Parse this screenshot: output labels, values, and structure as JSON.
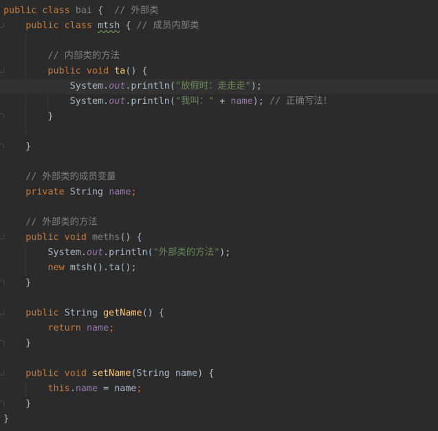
{
  "editor": {
    "lines": [
      [
        {
          "t": "public class ",
          "c": "kw"
        },
        {
          "t": "bai",
          "c": "un"
        },
        {
          "t": " {  "
        },
        {
          "t": "// 外部类",
          "c": "cm"
        }
      ],
      [
        {
          "t": "    "
        },
        {
          "t": "public class ",
          "c": "kw"
        },
        {
          "t": "mtsh",
          "c": "sq"
        },
        {
          "t": " { "
        },
        {
          "t": "// 成员内部类",
          "c": "cm"
        }
      ],
      [],
      [
        {
          "t": "        "
        },
        {
          "t": "// 内部类的方法",
          "c": "cm"
        }
      ],
      [
        {
          "t": "        "
        },
        {
          "t": "public void ",
          "c": "kw"
        },
        {
          "t": "ta",
          "c": "fn"
        },
        {
          "t": "() {"
        }
      ],
      [
        {
          "t": "            System."
        },
        {
          "t": "out",
          "c": "fi"
        },
        {
          "t": ".println("
        },
        {
          "t": "\"放假时：走走走\"",
          "c": "str"
        },
        {
          "t": ");"
        }
      ],
      [
        {
          "t": "            System."
        },
        {
          "t": "out",
          "c": "fi"
        },
        {
          "t": ".println("
        },
        {
          "t": "\"我叫：\"",
          "c": "str"
        },
        {
          "t": " + "
        },
        {
          "t": "name",
          "c": "fld"
        },
        {
          "t": "); "
        },
        {
          "t": "// 正确写法！",
          "c": "cm"
        }
      ],
      [
        {
          "t": "        }"
        }
      ],
      [],
      [
        {
          "t": "    }"
        }
      ],
      [],
      [
        {
          "t": "    "
        },
        {
          "t": "// 外部类的成员变量",
          "c": "cm"
        }
      ],
      [
        {
          "t": "    "
        },
        {
          "t": "private ",
          "c": "kw"
        },
        {
          "t": "String "
        },
        {
          "t": "name",
          "c": "fld"
        },
        {
          "t": ";",
          "c": "kw"
        }
      ],
      [],
      [
        {
          "t": "    "
        },
        {
          "t": "// 外部类的方法",
          "c": "cm"
        }
      ],
      [
        {
          "t": "    "
        },
        {
          "t": "public void ",
          "c": "kw"
        },
        {
          "t": "meths",
          "c": "un"
        },
        {
          "t": "() {"
        }
      ],
      [
        {
          "t": "        System."
        },
        {
          "t": "out",
          "c": "fi"
        },
        {
          "t": ".println("
        },
        {
          "t": "\"外部类的方法\"",
          "c": "str"
        },
        {
          "t": ");"
        }
      ],
      [
        {
          "t": "        "
        },
        {
          "t": "new ",
          "c": "kw"
        },
        {
          "t": "mtsh().ta();"
        }
      ],
      [
        {
          "t": "    }"
        }
      ],
      [],
      [
        {
          "t": "    "
        },
        {
          "t": "public ",
          "c": "kw"
        },
        {
          "t": "String "
        },
        {
          "t": "getName",
          "c": "fn"
        },
        {
          "t": "() {"
        }
      ],
      [
        {
          "t": "        "
        },
        {
          "t": "return ",
          "c": "kw"
        },
        {
          "t": "name",
          "c": "fld"
        },
        {
          "t": ";",
          "c": "kw"
        }
      ],
      [
        {
          "t": "    }"
        }
      ],
      [],
      [
        {
          "t": "    "
        },
        {
          "t": "public void ",
          "c": "kw"
        },
        {
          "t": "setName",
          "c": "fn"
        },
        {
          "t": "(String name) {"
        }
      ],
      [
        {
          "t": "        "
        },
        {
          "t": "this",
          "c": "kw"
        },
        {
          "t": "."
        },
        {
          "t": "name",
          "c": "fld"
        },
        {
          "t": " = name"
        },
        {
          "t": ";",
          "c": "kw"
        }
      ],
      [
        {
          "t": "    }"
        }
      ],
      [
        {
          "t": "}"
        }
      ]
    ]
  }
}
